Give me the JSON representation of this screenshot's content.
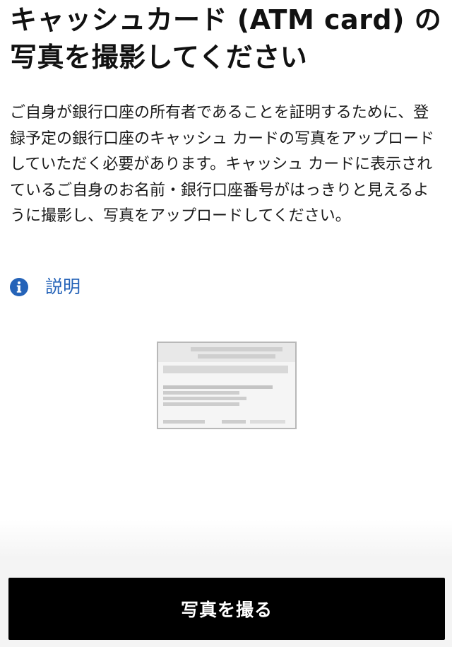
{
  "header": {
    "title": "キャッシュカード (ATM card) の写真を撮影してください"
  },
  "main": {
    "description": "ご自身が銀行口座の所有者であることを証明するために、登録予定の銀行口座のキャッシュ カードの写真をアップロードしていただく必要があります。キャッシュ カードに表示されているご自身のお名前・銀行口座番号がはっきりと見えるように撮影し、写真をアップロードしてください。",
    "explain_link": {
      "icon": "info-icon",
      "label": "説明"
    },
    "illustration": {
      "icon": "atm-card-placeholder-icon"
    }
  },
  "footer": {
    "primary_button_label": "写真を撮る"
  },
  "colors": {
    "background": "#ffffff",
    "text": "#111111",
    "link": "#2563b8",
    "button_background": "#000000",
    "button_text": "#ffffff",
    "footer_background": "#f4f4f4",
    "card_border": "#b8b8b8",
    "card_fill": "#f5f5f5",
    "card_bars": "#cfcfcf"
  }
}
